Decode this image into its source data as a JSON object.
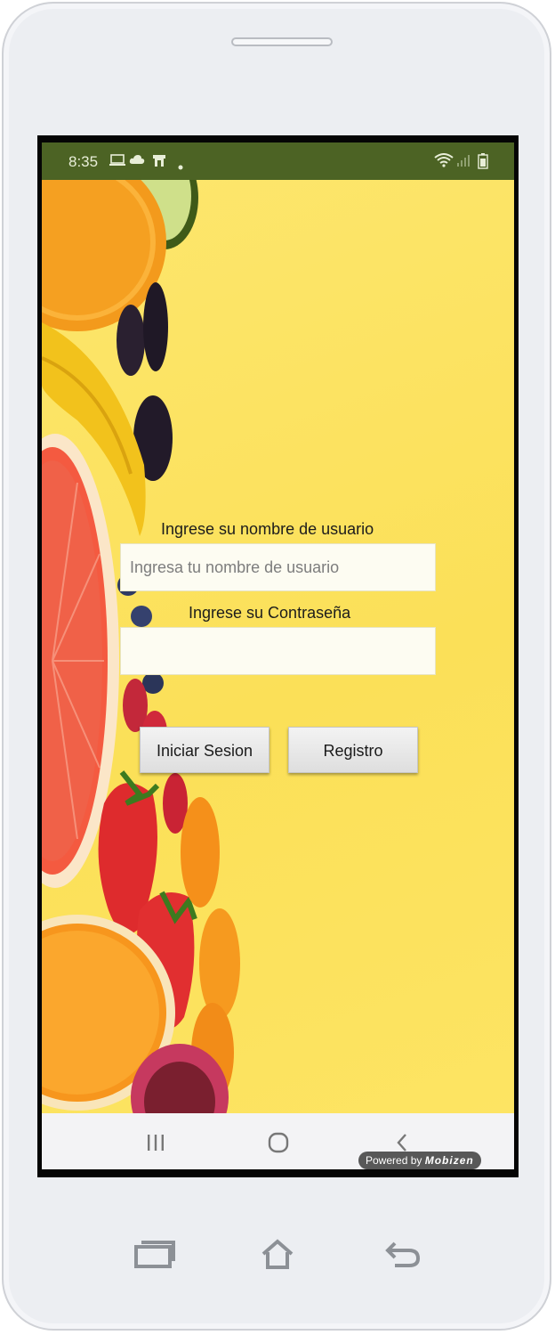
{
  "status_bar": {
    "time": "8:35",
    "left_icons": [
      "monitor-icon",
      "cloud-icon",
      "store-icon",
      "dot-icon"
    ],
    "right_icons": [
      "wifi-icon",
      "signal-icon",
      "battery-icon"
    ]
  },
  "login": {
    "username_label": "Ingrese su nombre de usuario",
    "username_placeholder": "Ingresa tu nombre de usuario",
    "username_value": "",
    "password_label": "Ingrese su Contraseña",
    "password_value": "",
    "login_button": "Iniciar Sesion",
    "register_button": "Registro"
  },
  "background": {
    "description_icon": "fruit-background-image"
  },
  "nav_bar": {
    "buttons": [
      "recent-apps-icon",
      "home-icon",
      "back-icon"
    ]
  },
  "watermark": {
    "prefix": "Powered by",
    "brand": "Mobizen"
  },
  "hardware_buttons": [
    "recents-hw-icon",
    "home-hw-icon",
    "back-hw-icon"
  ],
  "colors": {
    "status_bar": "#4c6324",
    "background_yellow": "#fce15c",
    "device_body": "#eceef2"
  }
}
